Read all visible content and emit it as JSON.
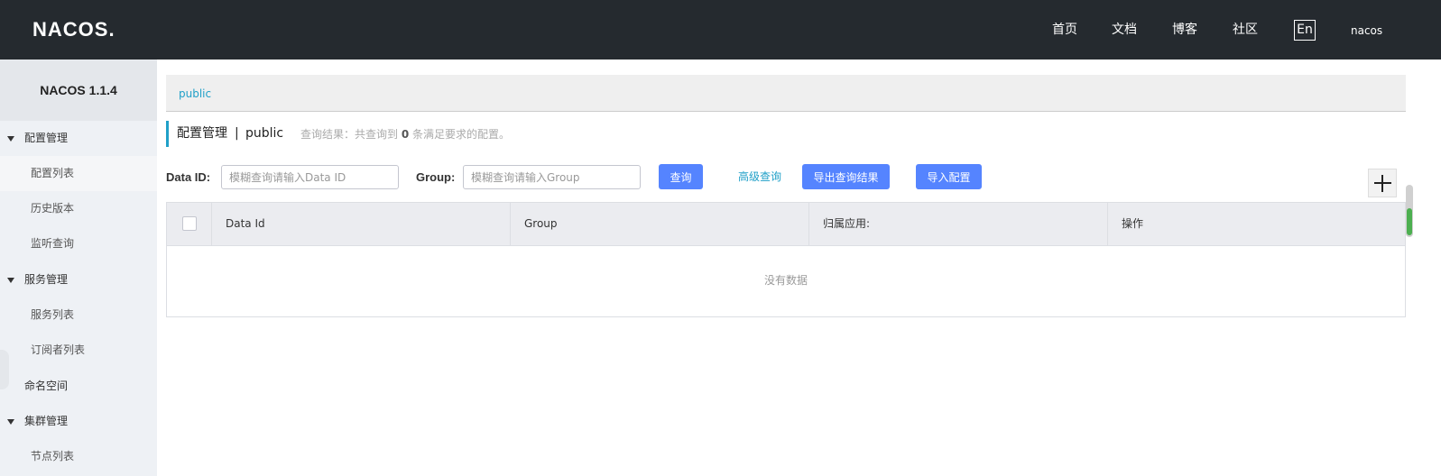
{
  "header": {
    "logo": "NACOS.",
    "nav": [
      "首页",
      "文档",
      "博客",
      "社区"
    ],
    "lang_button": "En",
    "user": "nacos"
  },
  "sidebar": {
    "version": "NACOS 1.1.4",
    "groups": [
      {
        "label": "配置管理",
        "items": [
          "配置列表",
          "历史版本",
          "监听查询"
        ],
        "active": "配置列表"
      },
      {
        "label": "服务管理",
        "items": [
          "服务列表",
          "订阅者列表"
        ]
      },
      {
        "label": "命名空间"
      },
      {
        "label": "集群管理",
        "items": [
          "节点列表"
        ]
      }
    ]
  },
  "main": {
    "namespace_tab": "public",
    "title": "配置管理",
    "title_sep": "|",
    "title_namespace": "public",
    "hint_prefix": "查询结果：共查询到",
    "hint_count": "0",
    "hint_suffix": "条满足要求的配置。",
    "form": {
      "data_id_label": "Data ID:",
      "data_id_placeholder": "模糊查询请输入Data ID",
      "group_label": "Group:",
      "group_placeholder": "模糊查询请输入Group",
      "query_button": "查询",
      "advanced_query": "高级查询",
      "export_button": "导出查询结果",
      "import_button": "导入配置"
    },
    "table": {
      "columns": [
        "Data Id",
        "Group",
        "归属应用:",
        "操作"
      ],
      "empty_text": "没有数据"
    }
  },
  "colors": {
    "header_bg": "#252a2f",
    "primary_button": "#5584ff",
    "link": "#20a0c8"
  }
}
